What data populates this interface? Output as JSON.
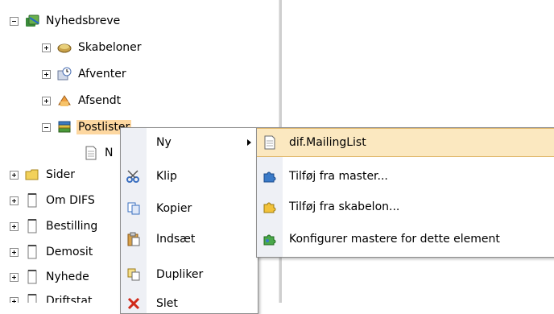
{
  "tree": {
    "items": [
      {
        "label": "Nyhedsbreve",
        "icon": "newsletter-icon",
        "expander": "minus"
      },
      {
        "label": "Skabeloner",
        "icon": "templates-icon",
        "expander": "plus"
      },
      {
        "label": "Afventer",
        "icon": "pending-clock-icon",
        "expander": "plus"
      },
      {
        "label": "Afsendt",
        "icon": "sent-icon",
        "expander": "plus"
      },
      {
        "label": "Postlister",
        "icon": "mailinglists-icon",
        "expander": "minus",
        "selected": true
      },
      {
        "label": "N",
        "icon": "document-icon",
        "expander": "none"
      },
      {
        "label": "Sider",
        "icon": "folder-icon",
        "expander": "plus"
      },
      {
        "label": "Om DIFS",
        "icon": "page-icon",
        "expander": "plus"
      },
      {
        "label": "Bestilling",
        "icon": "page-icon",
        "expander": "plus"
      },
      {
        "label": "Demosit",
        "icon": "page-icon",
        "expander": "plus"
      },
      {
        "label": "Nyhede",
        "icon": "page-icon",
        "expander": "plus"
      },
      {
        "label": "Driftstat",
        "icon": "page-icon",
        "expander": "plus"
      }
    ]
  },
  "context_menu": {
    "items": [
      {
        "label": "Ny",
        "icon": "none",
        "submenu": true
      },
      {
        "label": "Klip",
        "icon": "scissors-icon"
      },
      {
        "label": "Kopier",
        "icon": "copy-icon"
      },
      {
        "label": "Indsæt",
        "icon": "paste-icon"
      },
      {
        "label": "Dupliker",
        "icon": "duplicate-icon"
      },
      {
        "label": "Slet",
        "icon": "delete-x-icon"
      }
    ]
  },
  "submenu": {
    "items": [
      {
        "label": "dif.MailingList",
        "icon": "document-icon",
        "highlighted": true
      },
      {
        "label": "Tilføj fra master...",
        "icon": "puzzle-blue-icon"
      },
      {
        "label": "Tilføj fra skabelon...",
        "icon": "puzzle-yellow-icon"
      },
      {
        "label": "Konfigurer mastere for dette element",
        "icon": "puzzle-green-icon"
      }
    ]
  },
  "colors": {
    "selection_bg": "#fdd7a0",
    "menu_highlight": "#fbe8c0",
    "menu_gutter": "#eef0f5"
  }
}
